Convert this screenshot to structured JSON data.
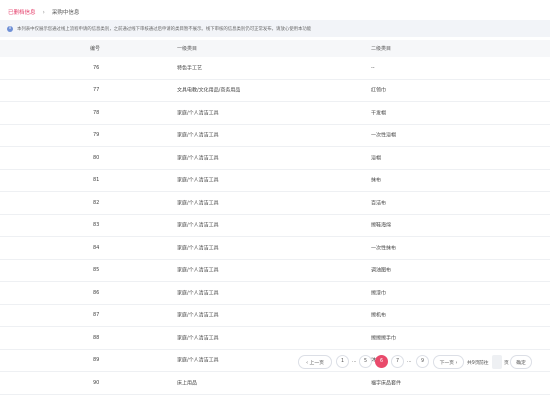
{
  "breadcrumb": {
    "parent": "已删档信息",
    "separator": "›",
    "current": "采购中信息"
  },
  "notice": {
    "icon": "info-icon",
    "text": "本列表中仅展示您通过线上流程申请的信息类别，之前通过线下审核通过后申请的类目暂不展示。线下审核的信息类别仍可正常发布，请放心使用本功能"
  },
  "table": {
    "headers": {
      "id": "编号",
      "category1": "一级类目",
      "category2": "二级类目"
    },
    "rows": [
      {
        "id": "76",
        "category1": "特色手工艺",
        "category2": "--"
      },
      {
        "id": "77",
        "category1": "文具电教/文化用品/商务用品",
        "category2": "红领巾"
      },
      {
        "id": "78",
        "category1": "家庭/个人清洁工具",
        "category2": "干发帽"
      },
      {
        "id": "79",
        "category1": "家庭/个人清洁工具",
        "category2": "一次性浴帽"
      },
      {
        "id": "80",
        "category1": "家庭/个人清洁工具",
        "category2": "浴帽"
      },
      {
        "id": "81",
        "category1": "家庭/个人清洁工具",
        "category2": "抹布"
      },
      {
        "id": "82",
        "category1": "家庭/个人清洁工具",
        "category2": "百洁布"
      },
      {
        "id": "83",
        "category1": "家庭/个人清洁工具",
        "category2": "擦鞋海绵"
      },
      {
        "id": "84",
        "category1": "家庭/个人清洁工具",
        "category2": "一次性抹布"
      },
      {
        "id": "85",
        "category1": "家庭/个人清洁工具",
        "category2": "调油图布"
      },
      {
        "id": "86",
        "category1": "家庭/个人清洁工具",
        "category2": "擦漆巾"
      },
      {
        "id": "87",
        "category1": "家庭/个人清洁工具",
        "category2": "擦机布"
      },
      {
        "id": "88",
        "category1": "家庭/个人清洁工具",
        "category2": "擦擦擦手巾"
      },
      {
        "id": "89",
        "category1": "家庭/个人清洁工具",
        "category2": "沐浴球"
      },
      {
        "id": "90",
        "category1": "床上用品",
        "category2": "福字床品套件"
      }
    ]
  },
  "pagination": {
    "prev": "‹ 上一页",
    "pages": [
      "1",
      "···",
      "5",
      "6",
      "7",
      "···",
      "9"
    ],
    "active_page": "6",
    "next": "下一页 ›",
    "total_pages": "共9页",
    "goto_label": "前往",
    "goto_value": "",
    "page_suffix": "页",
    "confirm": "确定",
    "accent_color": "#e94a6b"
  }
}
